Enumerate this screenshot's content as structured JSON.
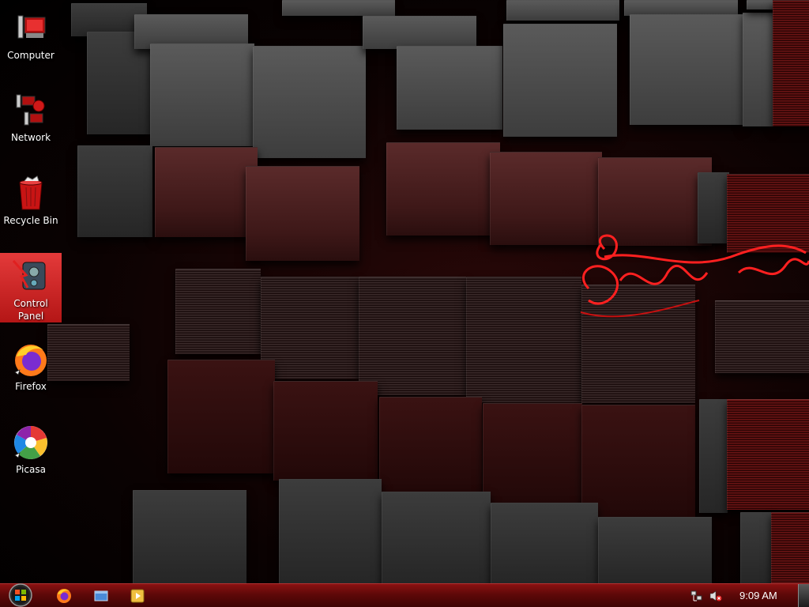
{
  "desktop": {
    "icons": [
      {
        "label": "Computer",
        "icon": "computer-icon"
      },
      {
        "label": "Network",
        "icon": "network-icon"
      },
      {
        "label": "Recycle Bin",
        "icon": "recycle-bin-icon"
      },
      {
        "label": "Control Panel",
        "icon": "control-panel-icon",
        "selected": true
      },
      {
        "label": "Firefox",
        "icon": "firefox-icon"
      },
      {
        "label": "Picasa",
        "icon": "picasa-icon"
      }
    ]
  },
  "taskbar": {
    "start": {
      "icon": "windows-orb-icon"
    },
    "quick_launch": [
      {
        "icon": "firefox-icon"
      },
      {
        "icon": "show-desktop-icon"
      },
      {
        "icon": "media-player-icon"
      }
    ],
    "tray": {
      "icons": [
        "network-status-icon",
        "volume-muted-icon"
      ],
      "clock": "9:09 AM"
    }
  },
  "colors": {
    "taskbar": "#6a0a0a",
    "accent": "#d42020",
    "selection": "#c82020"
  }
}
